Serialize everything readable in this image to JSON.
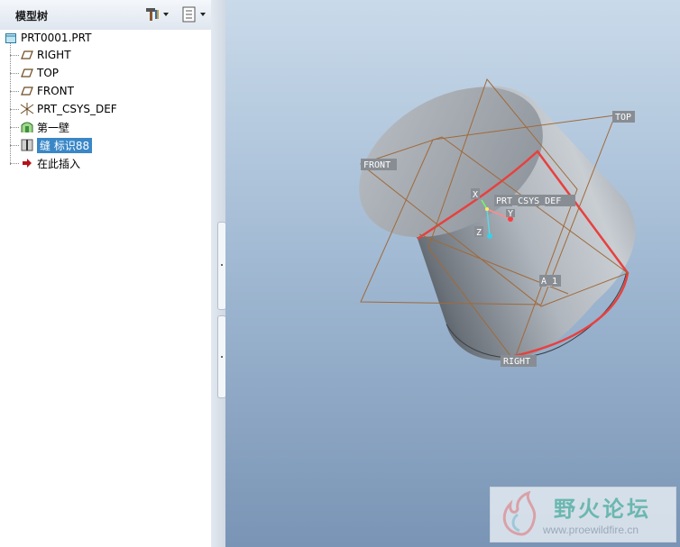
{
  "panel": {
    "title": "模型树",
    "tools_icon": "hammer-icon",
    "view_icon": "list-icon"
  },
  "tree": {
    "root": "PRT0001.PRT",
    "items": [
      {
        "label": "RIGHT",
        "icon": "datum-plane-icon"
      },
      {
        "label": "TOP",
        "icon": "datum-plane-icon"
      },
      {
        "label": "FRONT",
        "icon": "datum-plane-icon"
      },
      {
        "label": "PRT_CSYS_DEF",
        "icon": "csys-icon"
      },
      {
        "label": "第一壁",
        "icon": "wall-icon"
      },
      {
        "label": "缝 标识88",
        "icon": "rip-icon",
        "selected": true
      },
      {
        "label": "在此插入",
        "icon": "insert-arrow-icon"
      }
    ]
  },
  "viewport": {
    "datum_labels": {
      "top": "TOP",
      "front": "FRONT",
      "right": "RIGHT",
      "csys": "PRT_CSYS_DEF",
      "axis": "A_1",
      "x": "X",
      "y": "Y",
      "z": "Z"
    },
    "colors": {
      "datum": "#a06a3a",
      "highlight": "#e8403e",
      "bg_top": "#c9daea",
      "bg_bottom": "#7994b5"
    }
  },
  "watermark": {
    "title": "野火论坛",
    "url": "www.proewildfire.cn"
  }
}
